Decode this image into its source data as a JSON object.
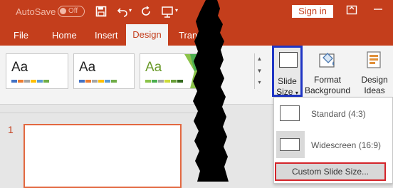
{
  "titlebar": {
    "autosave_label": "AutoSave",
    "autosave_state": "Off",
    "save_icon": "save-icon",
    "undo_icon": "undo-icon",
    "redo_icon": "redo-icon",
    "present_icon": "present-from-start-icon",
    "sign_in": "Sign in",
    "colors": {
      "accent": "#c43e1c"
    }
  },
  "tabs": [
    {
      "label": "File"
    },
    {
      "label": "Home"
    },
    {
      "label": "Insert"
    },
    {
      "label": "Design",
      "active": true
    },
    {
      "label": "Trans"
    }
  ],
  "themes": [
    {
      "text": "Aa",
      "bars": [
        "#4472c4",
        "#ed7d31",
        "#a5a5a5",
        "#ffc000",
        "#5b9bd5",
        "#70ad47"
      ]
    },
    {
      "text": "Aa",
      "bars": [
        "#4472c4",
        "#ed7d31",
        "#a5a5a5",
        "#ffc000",
        "#5b9bd5",
        "#70ad47"
      ]
    },
    {
      "text": "Aa",
      "bars": [
        "#8bc34a",
        "#4caf50",
        "#a5a5a5",
        "#cddc39",
        "#689f38",
        "#33691e"
      ]
    }
  ],
  "ribbon": {
    "slide_size": {
      "line1": "Slide",
      "line2": "Size"
    },
    "format_background": {
      "line1": "Format",
      "line2": "Background"
    },
    "design_ideas": {
      "line1": "Design",
      "line2": "Ideas"
    }
  },
  "slides": [
    {
      "number": "1"
    }
  ],
  "slide_size_menu": {
    "items": [
      {
        "label": "Standard (4:3)"
      },
      {
        "label": "Widescreen (16:9)"
      }
    ],
    "custom": "Custom Slide Size..."
  }
}
